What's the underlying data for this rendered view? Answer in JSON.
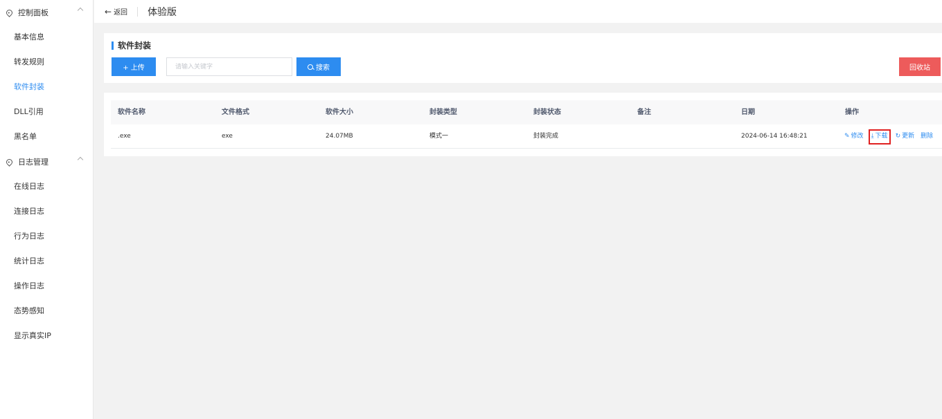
{
  "sidebar": {
    "group1": {
      "label": "控制面板",
      "items": [
        "基本信息",
        "转发规则",
        "软件封装",
        "DLL引用",
        "黑名单"
      ]
    },
    "group2": {
      "label": "日志管理",
      "items": [
        "在线日志",
        "连接日志",
        "行为日志",
        "统计日志",
        "操作日志",
        "态势感知",
        "显示真实IP"
      ]
    },
    "active_item": "软件封装"
  },
  "topbar": {
    "back_label": "返回",
    "title": "体验版"
  },
  "section": {
    "title": "软件封装",
    "upload_label": "+ 上传",
    "search_placeholder": "请输入关键字",
    "search_label": "搜索",
    "recycle_label": "回收站"
  },
  "table": {
    "columns": [
      "软件名称",
      "文件格式",
      "软件大小",
      "封装类型",
      "封装状态",
      "备注",
      "日期",
      "操作"
    ],
    "rows": [
      {
        "name": ".exe",
        "format": "exe",
        "size": "24.07MB",
        "type": "模式一",
        "status": "封装完成",
        "note": "",
        "date": "2024-06-14 16:48:21"
      }
    ],
    "actions": {
      "edit": "修改",
      "download": "下载",
      "update": "更新",
      "delete": "删除"
    }
  },
  "colors": {
    "accent": "#2d8cf0",
    "danger": "#ed5b5b",
    "highlight": "#e02020"
  }
}
